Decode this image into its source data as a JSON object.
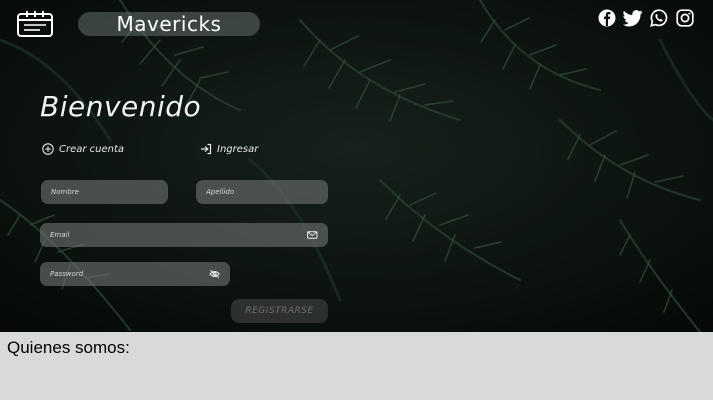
{
  "header": {
    "brand": "Mavericks",
    "logo_icon": "calendar-icon",
    "social": [
      "facebook-icon",
      "twitter-icon",
      "whatsapp-icon",
      "instagram-icon"
    ]
  },
  "form": {
    "title": "Bienvenido",
    "tab_create": "Crear cuenta",
    "tab_login": "Ingresar",
    "nombre_placeholder": "Nombre",
    "apellido_placeholder": "Apellido",
    "email_placeholder": "Email",
    "password_placeholder": "Password",
    "submit_label": "REGISTRARSE"
  },
  "about": {
    "heading": "Quienes somos:"
  }
}
